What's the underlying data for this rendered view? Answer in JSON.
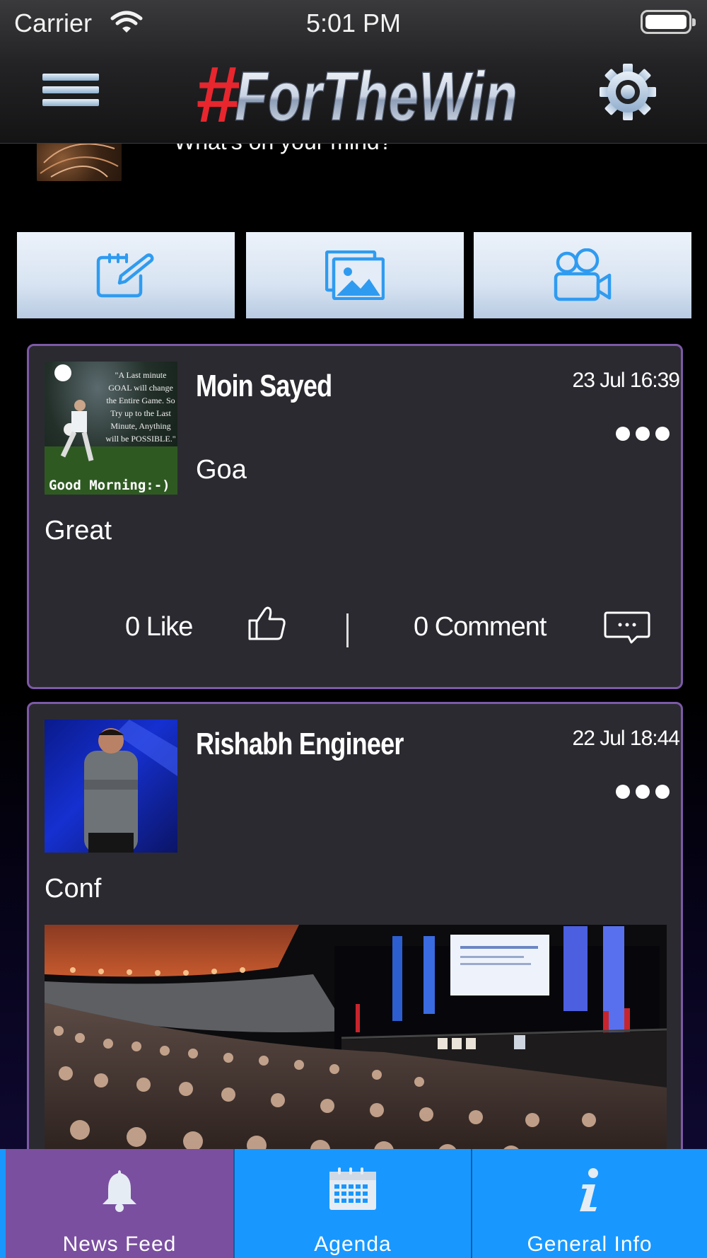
{
  "status_bar": {
    "carrier": "Carrier",
    "time": "5:01 PM"
  },
  "header": {
    "logo_hash": "#",
    "logo_text": "ForTheWin",
    "logo_alt": "#ForTheWin"
  },
  "composer": {
    "prompt": "What's on your mind?"
  },
  "actions": [
    {
      "icon": "compose-icon"
    },
    {
      "icon": "photo-icon"
    },
    {
      "icon": "video-camera-icon"
    }
  ],
  "posts": [
    {
      "author": "Moin Sayed",
      "date": "23 Jul 16:39",
      "location": "Goa",
      "text": "Great",
      "likes": "0 Like",
      "comments": "0 Comment",
      "photo_caption_top": "\"A Last minute GOAL will change the Entire Game. So Try up to the Last Minute, Anything will be POSSIBLE.\"",
      "photo_caption_bottom": "Good Morning:-)"
    },
    {
      "author": "Rishabh Engineer",
      "date": "22 Jul 18:44",
      "text": "Conf"
    }
  ],
  "tabs": [
    {
      "label": "News Feed",
      "icon": "bell-icon",
      "active": true,
      "color": "#7b4fa0"
    },
    {
      "label": "Agenda",
      "icon": "calendar-icon",
      "active": false
    },
    {
      "label": "General Info",
      "icon": "info-icon",
      "active": false
    }
  ],
  "colors": {
    "accent_purple": "#7d59a8",
    "tab_blue": "#1898ff",
    "icon_blue": "#2f9bf0",
    "logo_red": "#e8262e"
  }
}
